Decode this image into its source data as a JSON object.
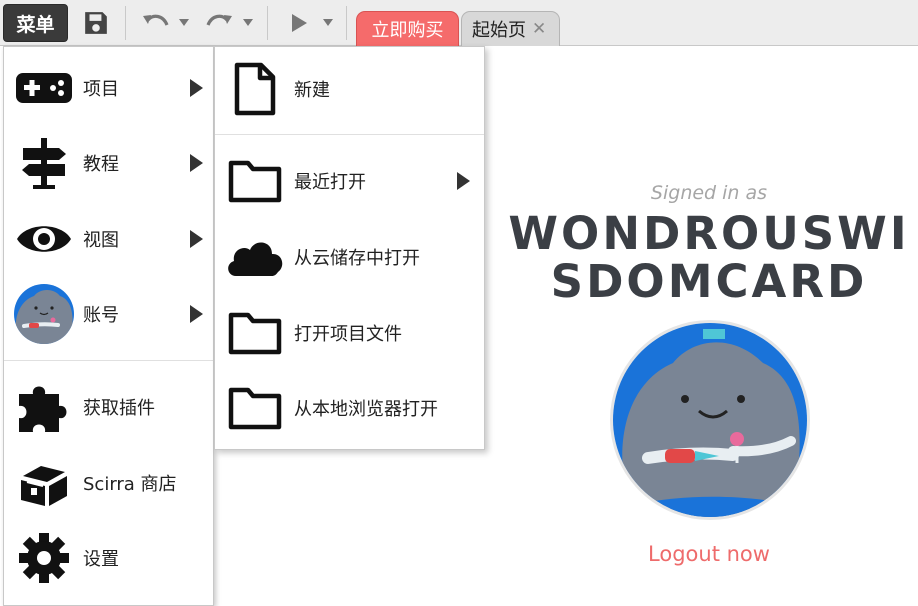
{
  "toolbar": {
    "menu_label": "菜单",
    "tabs": [
      {
        "label": "立即购买",
        "color": "#f56b6b"
      },
      {
        "label": "起始页",
        "close_glyph": "✕"
      }
    ]
  },
  "main_menu": {
    "items": [
      {
        "label": "项目",
        "icon": "gamepad-icon",
        "submenu": true
      },
      {
        "label": "教程",
        "icon": "signpost-icon",
        "submenu": true
      },
      {
        "label": "视图",
        "icon": "eye-icon",
        "submenu": true
      },
      {
        "label": "账号",
        "icon": "avatar",
        "submenu": true
      },
      {
        "label": "获取插件",
        "icon": "puzzle-icon",
        "submenu": false
      },
      {
        "label": "Scirra 商店",
        "icon": "treasure-chest-icon",
        "submenu": false
      },
      {
        "label": "设置",
        "icon": "gear-icon",
        "submenu": false
      }
    ]
  },
  "sub_menu": {
    "items": [
      {
        "label": "新建",
        "icon": "new-file-icon",
        "submenu": false
      },
      {
        "label": "最近打开",
        "icon": "folder-icon",
        "submenu": true
      },
      {
        "label": "从云储存中打开",
        "icon": "cloud-icon",
        "submenu": false
      },
      {
        "label": "打开项目文件",
        "icon": "folder-icon",
        "submenu": false
      },
      {
        "label": "从本地浏览器打开",
        "icon": "folder-icon",
        "submenu": false
      }
    ]
  },
  "account": {
    "signed_in_label": "Signed in as",
    "username": "WONDROUSWISDOMCARD",
    "logout_label": "Logout now",
    "logout_color": "#ee6b6b"
  }
}
